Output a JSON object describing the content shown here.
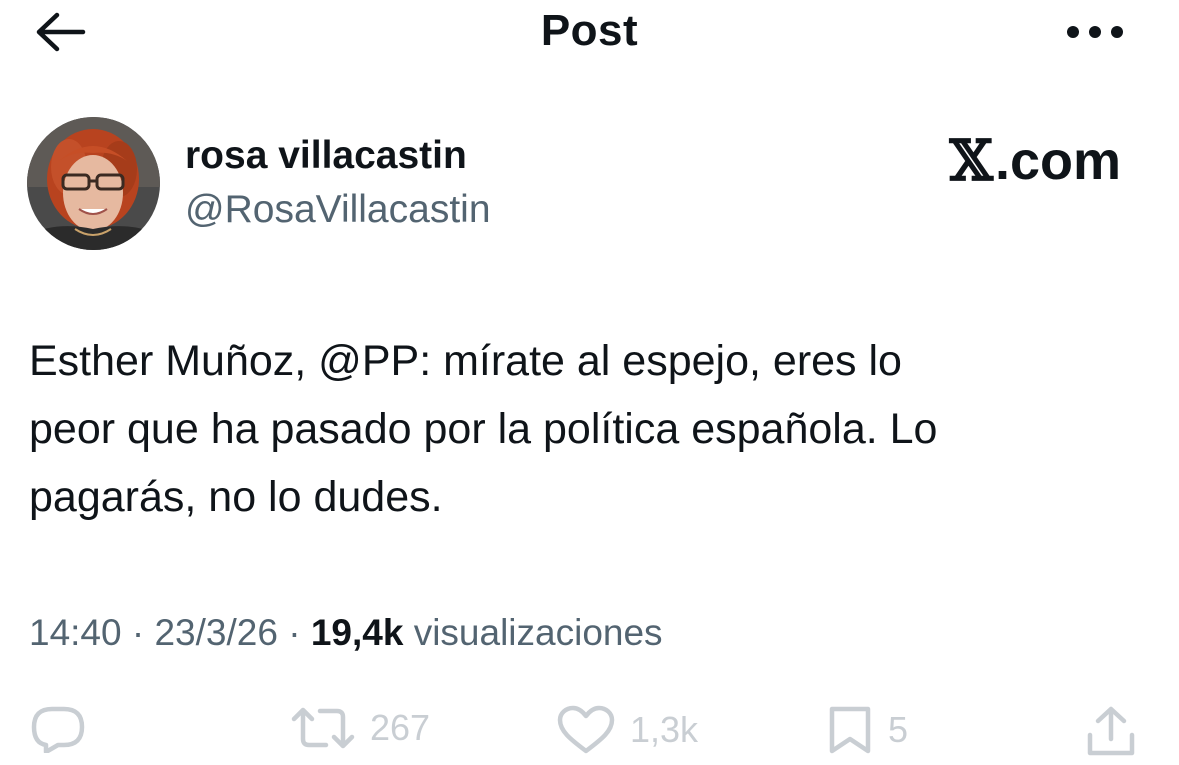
{
  "header": {
    "title": "Post",
    "back_icon": "arrow-left-icon",
    "more_icon": "more-horizontal-icon"
  },
  "author": {
    "name": "rosa villacastin",
    "handle": "@RosaVillacastin",
    "avatar_icon": "avatar-photo"
  },
  "brand": {
    "logo_mark": "𝕏",
    "logo_text": ".com"
  },
  "post": {
    "lines": [
      "Esther Muñoz,  @PP: mírate al espejo, eres lo",
      "peor que ha pasado por la política española. Lo",
      "pagarás, no lo dudes."
    ]
  },
  "meta": {
    "time": "14:40",
    "date": "23/3/26",
    "separator": "·",
    "views_count": "19,4k",
    "views_label": "visualizaciones"
  },
  "actions": {
    "reply_icon": "reply-icon",
    "retweet_count": "267",
    "like_count": "1,3k",
    "bookmark_count": "5",
    "share_icon": "share-icon"
  },
  "colors": {
    "text_primary": "#0f1419",
    "text_secondary": "#536471",
    "action_faded": "#c9ced3",
    "background": "#ffffff"
  }
}
